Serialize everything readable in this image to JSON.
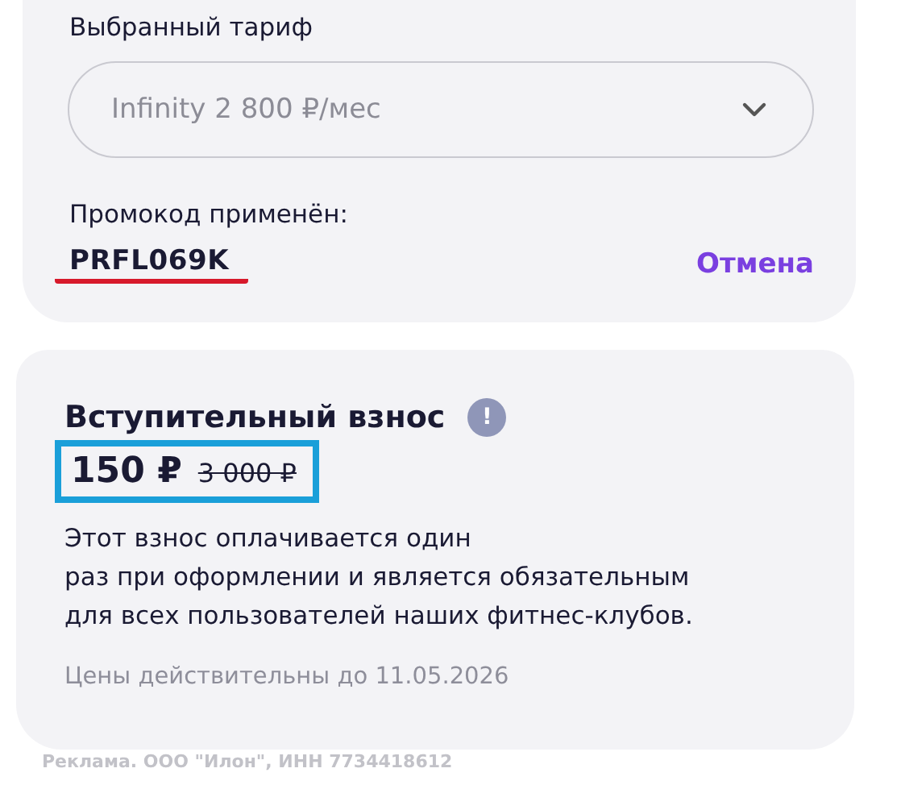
{
  "tariff": {
    "label": "Выбранный тариф",
    "value": "Infinity 2 800 ₽/мес"
  },
  "promo": {
    "label": "Промокод применён:",
    "code": "PRFL069K",
    "code_underlined": true,
    "cancel": "Отмена"
  },
  "fee": {
    "title": "Вступительный взнос",
    "info_icon": "!",
    "price": "150 ₽",
    "old_price": "3 000 ₽",
    "price_highlighted": true,
    "description": [
      "Этот взнос оплачивается один",
      "раз при оформлении и является обязательным",
      "для всех пользователей наших фитнес-клубов."
    ],
    "validity": "Цены действительны до 11.05.2026"
  },
  "ad_note": "Реклама. ООО \"Илон\", ИНН 7734418612"
}
